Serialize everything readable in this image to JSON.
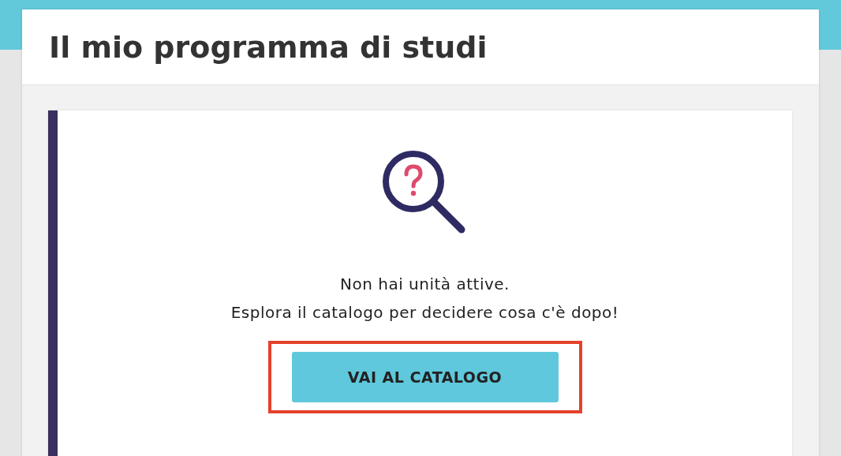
{
  "page": {
    "title": "Il mio programma di studi"
  },
  "empty_state": {
    "lines": [
      "Non hai unità attive.",
      "Esplora il catalogo per decidere cosa c'è dopo!"
    ],
    "button": {
      "label": "VAI AL CATALOGO",
      "highlighted": true
    }
  }
}
